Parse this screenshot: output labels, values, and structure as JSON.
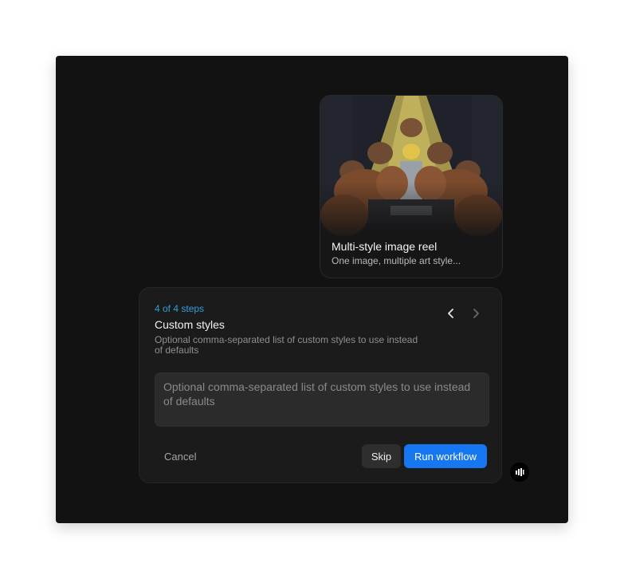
{
  "workflow_card": {
    "title": "Multi-style image reel",
    "subtitle": "One image, multiple art style...",
    "image_icon": "pixel-art-portrait-image"
  },
  "step": {
    "counter": "4 of 4 steps",
    "title": "Custom styles",
    "description": "Optional comma-separated list of custom styles to use instead of defaults",
    "prev_icon": "chevron-left-icon",
    "next_icon": "chevron-right-icon"
  },
  "input": {
    "placeholder": "Optional comma-separated list of custom styles to use instead of defaults",
    "value": ""
  },
  "actions": {
    "cancel_label": "Cancel",
    "skip_label": "Skip",
    "run_label": "Run workflow"
  },
  "floating": {
    "logo_icon": "brand-logo-icon"
  },
  "colors": {
    "window_bg": "#121212",
    "panel_bg": "#1b1b1b",
    "accent": "#1677f0",
    "step_counter": "#2f9fd8"
  }
}
